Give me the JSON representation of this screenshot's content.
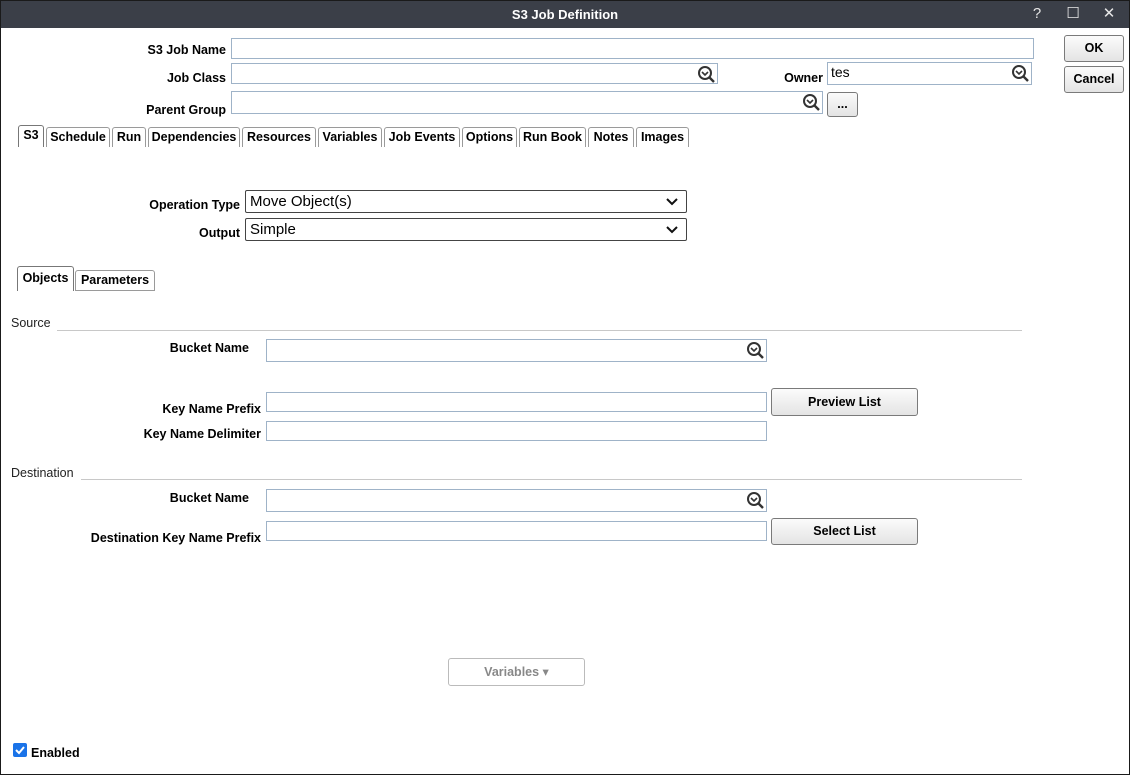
{
  "window": {
    "title": "S3 Job Definition",
    "controls": {
      "help": "?",
      "maximize": "☐",
      "close": "✕"
    }
  },
  "header": {
    "job_name_label": "S3 Job Name",
    "job_name_value": "",
    "job_class_label": "Job Class",
    "job_class_value": "",
    "owner_label": "Owner",
    "owner_value": "tes",
    "parent_group_label": "Parent Group",
    "parent_group_value": "",
    "browse_label": "...",
    "ok_label": "OK",
    "cancel_label": "Cancel"
  },
  "tabs": [
    "S3",
    "Schedule",
    "Run",
    "Dependencies",
    "Resources",
    "Variables",
    "Job Events",
    "Options",
    "Run Book",
    "Notes",
    "Images"
  ],
  "active_tab": "S3",
  "operation": {
    "type_label": "Operation Type",
    "type_value": "Move Object(s)",
    "output_label": "Output",
    "output_value": "Simple"
  },
  "subtabs": [
    "Objects",
    "Parameters"
  ],
  "active_subtab": "Objects",
  "source": {
    "section_label": "Source",
    "bucket_label": "Bucket Name",
    "bucket_value": "",
    "prefix_label": "Key Name Prefix",
    "prefix_value": "",
    "delimiter_label": "Key Name Delimiter",
    "delimiter_value": "",
    "preview_button": "Preview List"
  },
  "destination": {
    "section_label": "Destination",
    "bucket_label": "Bucket Name",
    "bucket_value": "",
    "prefix_label": "Destination Key Name Prefix",
    "prefix_value": "",
    "select_button": "Select List"
  },
  "footer": {
    "variables_button": "Variables ▾",
    "enabled_label": "Enabled",
    "enabled_checked": true
  },
  "colors": {
    "titlebar": "#3b3f48",
    "field_border": "#9fb3c8",
    "checkbox": "#1a73e8"
  }
}
